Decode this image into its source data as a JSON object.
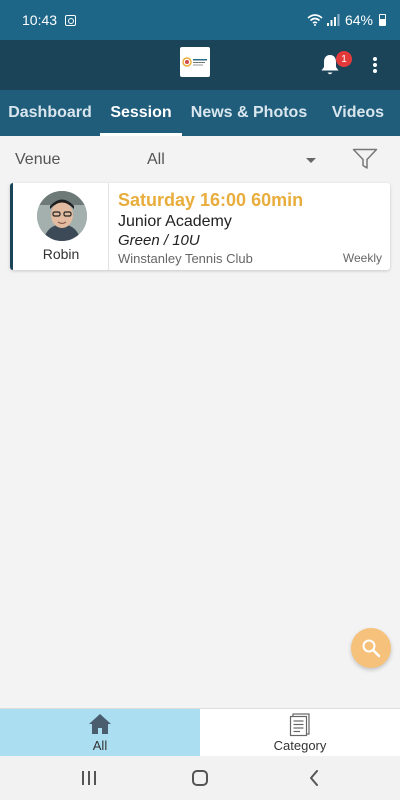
{
  "status_bar": {
    "time": "10:43",
    "battery": "64%"
  },
  "header": {
    "notification_count": "1",
    "logo_icon": "club-logo-icon",
    "colors": {
      "header_bg": "#1c4459",
      "tabs_bg": "#1f5d7b",
      "accent": "#e8ad3c",
      "badge": "#e23a3a"
    }
  },
  "tabs": [
    {
      "label": "Dashboard",
      "active": false
    },
    {
      "label": "Session",
      "active": true
    },
    {
      "label": "News & Photos",
      "active": false
    },
    {
      "label": "Videos",
      "active": false
    }
  ],
  "filter": {
    "label": "Venue",
    "selected": "All"
  },
  "sessions": [
    {
      "coach": "Robin",
      "time": "Saturday 16:00 60min",
      "program": "Junior Academy",
      "level": "Green / 10U",
      "venue": "Winstanley Tennis Club",
      "frequency": "Weekly"
    }
  ],
  "bottom_nav": [
    {
      "label": "All",
      "icon": "home-icon",
      "active": true
    },
    {
      "label": "Category",
      "icon": "list-icon",
      "active": false
    }
  ]
}
